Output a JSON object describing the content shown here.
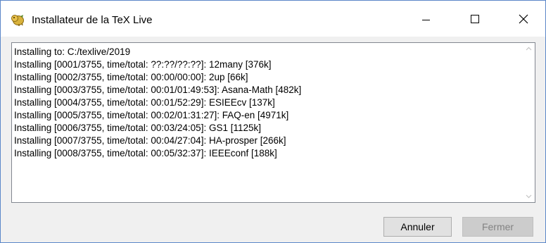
{
  "window": {
    "title": "Installateur de la TeX Live",
    "controls": {
      "minimize_icon": "minimize-icon",
      "maximize_icon": "maximize-icon",
      "close_icon": "close-icon"
    }
  },
  "log": {
    "lines": [
      "Installing to: C:/texlive/2019",
      "Installing [0001/3755, time/total: ??:??/??:??]: 12many [376k]",
      "Installing [0002/3755, time/total: 00:00/00:00]: 2up [66k]",
      "Installing [0003/3755, time/total: 00:01/01:49:53]: Asana-Math [482k]",
      "Installing [0004/3755, time/total: 00:01/52:29]: ESIEEcv [137k]",
      "Installing [0005/3755, time/total: 00:02/01:31:27]: FAQ-en [4971k]",
      "Installing [0006/3755, time/total: 00:03/24:05]: GS1 [1125k]",
      "Installing [0007/3755, time/total: 00:04/27:04]: HA-prosper [266k]",
      "Installing [0008/3755, time/total: 00:05/32:37]: IEEEconf [188k]"
    ]
  },
  "buttons": {
    "cancel_label": "Annuler",
    "close_label": "Fermer",
    "close_enabled": false
  },
  "colors": {
    "window_border": "#5b87c9",
    "dialog_bg": "#f0f0f0",
    "disabled_text": "#838383"
  }
}
